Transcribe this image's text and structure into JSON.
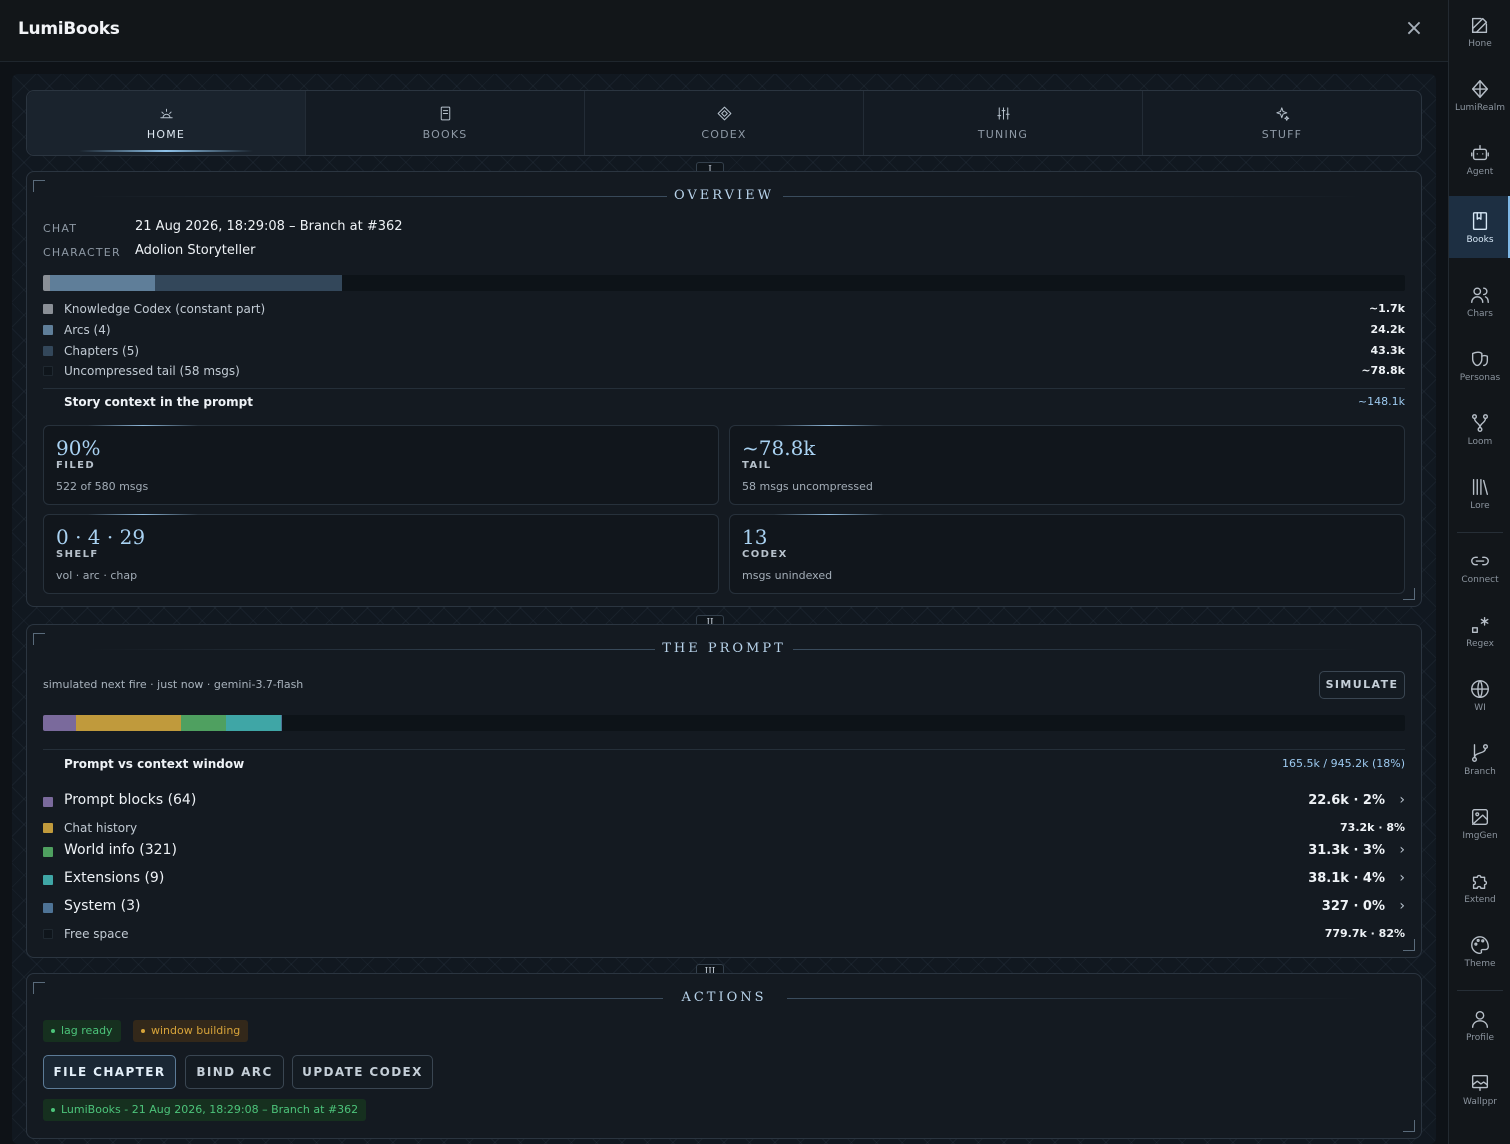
{
  "app": {
    "title": "LumiBooks",
    "close_icon": "×"
  },
  "tabs": [
    {
      "label": "HOME",
      "icon": "sunrise-icon",
      "active": true
    },
    {
      "label": "BOOKS",
      "icon": "book-icon"
    },
    {
      "label": "CODEX",
      "icon": "diamond-icon"
    },
    {
      "label": "TUNING",
      "icon": "sliders-icon"
    },
    {
      "label": "STUFF",
      "icon": "sparkle-icon"
    }
  ],
  "rail": [
    {
      "label": "Hone",
      "icon": "pencil-square-icon"
    },
    {
      "label": "LumiRealm",
      "icon": "gem-icon"
    },
    {
      "label": "Agent",
      "icon": "bot-icon"
    },
    {
      "label": "Books",
      "icon": "book-icon",
      "active": true
    },
    {
      "label": "Chars",
      "icon": "users-icon"
    },
    {
      "label": "Personas",
      "icon": "masks-icon"
    },
    {
      "label": "Loom",
      "icon": "fork-icon"
    },
    {
      "label": "Lore",
      "icon": "library-icon"
    },
    {
      "label": "Connect",
      "icon": "link-icon"
    },
    {
      "label": "Regex",
      "icon": "regex-icon"
    },
    {
      "label": "WI",
      "icon": "globe-icon"
    },
    {
      "label": "Branch",
      "icon": "git-branch-icon"
    },
    {
      "label": "ImgGen",
      "icon": "image-icon"
    },
    {
      "label": "Extend",
      "icon": "puzzle-icon"
    },
    {
      "label": "Theme",
      "icon": "palette-icon"
    },
    {
      "label": "Profile",
      "icon": "user-icon"
    },
    {
      "label": "Wallppr",
      "icon": "wallpaper-icon"
    }
  ],
  "overview": {
    "roman": "I",
    "title": "OVERVIEW",
    "chat_key": "CHAT",
    "chat_value": "21 Aug 2026, 18:29:08 – Branch at #362",
    "character_key": "CHARACTER",
    "character_value": "Adolion Storyteller",
    "legend": [
      {
        "label": "Knowledge Codex (constant part)",
        "value": "~1.7k",
        "color": "#8a8f96"
      },
      {
        "label": "Arcs (4)",
        "value": "24.2k",
        "color": "#5f7e99"
      },
      {
        "label": "Chapters (5)",
        "value": "43.3k",
        "color": "#33475a"
      },
      {
        "label": "Uncompressed tail (58 msgs)",
        "value": "~78.8k",
        "color": "#0f151b"
      }
    ],
    "bar_values": [
      1.7,
      24.2,
      43.3,
      78.8
    ],
    "total_label": "Story context in the prompt",
    "total_value": "~148.1k",
    "stats": [
      {
        "value": "90%",
        "label": "FILED",
        "sub": "522 of 580 msgs"
      },
      {
        "value": "~78.8k",
        "label": "TAIL",
        "sub": "58 msgs uncompressed"
      },
      {
        "value": "0 · 4 · 29",
        "label": "SHELF",
        "sub": "vol · arc · chap"
      },
      {
        "value": "13",
        "label": "CODEX",
        "sub": "msgs unindexed"
      }
    ]
  },
  "prompt": {
    "roman": "II",
    "title": "THE PROMPT",
    "sim_info": "simulated next fire · just now · gemini-3.7-flash",
    "simulate_label": "SIMULATE",
    "bar_values": [
      22.6,
      73.2,
      31.3,
      38.1,
      0.327,
      779.7
    ],
    "total_label": "Prompt vs context window",
    "total_value": "165.5k / 945.2k (18%)",
    "legend": [
      {
        "label": "Prompt blocks (64)",
        "value": "22.6k · 2%",
        "color": "#7a6a9c",
        "expandable": true
      },
      {
        "label": "Chat history",
        "value": "73.2k · 8%",
        "color": "#c09a3c",
        "expandable": false
      },
      {
        "label": "World info (321)",
        "value": "31.3k · 3%",
        "color": "#4fa060",
        "expandable": true
      },
      {
        "label": "Extensions (9)",
        "value": "38.1k · 4%",
        "color": "#3fa6a6",
        "expandable": true
      },
      {
        "label": "System (3)",
        "value": "327 · 0%",
        "color": "#4e7396",
        "expandable": true
      },
      {
        "label": "Free space",
        "value": "779.7k · 82%",
        "color": "#0f151b",
        "expandable": false
      }
    ]
  },
  "actions": {
    "roman": "III",
    "title": "ACTIONS",
    "badges": [
      {
        "label": "lag ready",
        "color": "#4cc37a",
        "bg": "#16301f"
      },
      {
        "label": "window building",
        "color": "#d7a33a",
        "bg": "#33281a"
      }
    ],
    "buttons": [
      "FILE CHAPTER",
      "BIND ARC",
      "UPDATE CODEX"
    ],
    "status": "LumiBooks - 21 Aug 2026, 18:29:08 – Branch at #362"
  }
}
